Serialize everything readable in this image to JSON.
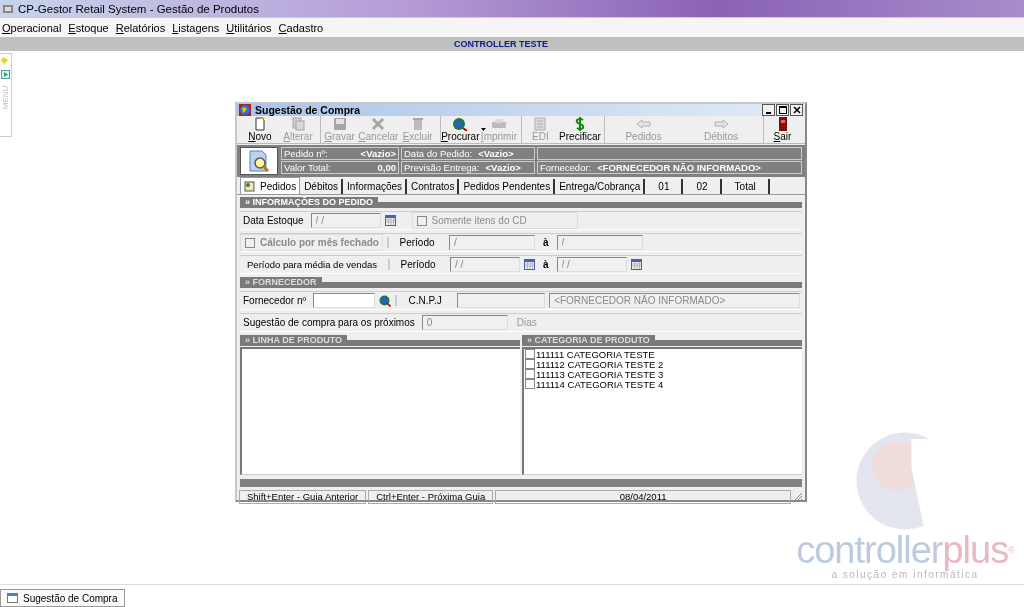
{
  "app": {
    "title": "CP-Gestor Retail System - Gestão de Produtos",
    "menu": [
      {
        "label": "Operacional",
        "mnemonic": true
      },
      {
        "label": "Estoque",
        "mnemonic": true
      },
      {
        "label": "Relatórios",
        "mnemonic": true
      },
      {
        "label": "Listagens",
        "mnemonic": true
      },
      {
        "label": "Utilitários",
        "mnemonic": true
      },
      {
        "label": "Cadastro",
        "mnemonic": true
      }
    ],
    "company": "CONTROLLER TESTE"
  },
  "side_panel": {
    "label": "MENU"
  },
  "window": {
    "title": "Sugestão de Compra",
    "toolbar": [
      {
        "label": "Novo",
        "disabled": false,
        "mnemonic": true,
        "group_start": false,
        "dropdown": false
      },
      {
        "label": "Alterar",
        "disabled": true,
        "mnemonic": true,
        "group_start": false,
        "dropdown": false
      },
      {
        "label": "Gravar",
        "disabled": true,
        "mnemonic": true,
        "group_start": true,
        "dropdown": false
      },
      {
        "label": "Cancelar",
        "disabled": true,
        "mnemonic": true,
        "group_start": false,
        "dropdown": false
      },
      {
        "label": "Excluir",
        "disabled": true,
        "mnemonic": true,
        "group_start": false,
        "dropdown": false
      },
      {
        "label": "Procurar",
        "disabled": false,
        "mnemonic": true,
        "group_start": true,
        "dropdown": true
      },
      {
        "label": "Imprimir",
        "disabled": true,
        "mnemonic": true,
        "group_start": false,
        "dropdown": false
      },
      {
        "label": "EDI",
        "disabled": true,
        "mnemonic": false,
        "group_start": true,
        "dropdown": false
      },
      {
        "label": "Precificar",
        "disabled": false,
        "mnemonic": false,
        "group_start": false,
        "dropdown": false
      },
      {
        "label": "Pedidos",
        "disabled": true,
        "mnemonic": false,
        "group_start": true,
        "dropdown": false
      },
      {
        "label": "Débitos",
        "disabled": true,
        "mnemonic": false,
        "group_start": false,
        "dropdown": false
      },
      {
        "label": "Sair",
        "disabled": false,
        "mnemonic": true,
        "group_start": true,
        "dropdown": false
      }
    ],
    "header": {
      "rows": [
        [
          {
            "label": "Pedido nº:",
            "value": "<Vazio>"
          },
          {
            "label": "Data do Pedido:",
            "value": "<Vazio>"
          }
        ],
        [
          {
            "label": "Valor Total:",
            "value": "0,00"
          },
          {
            "label": "Previsão Entrega:",
            "value": "<Vazio>"
          },
          {
            "label": "Fornecedor:",
            "value": "<FORNECEDOR NÃO INFORMADO>"
          }
        ]
      ]
    },
    "tabs": [
      {
        "label": "Pedidos",
        "selected": true
      },
      {
        "label": "Débitos",
        "selected": false
      },
      {
        "label": "Informações",
        "selected": false
      },
      {
        "label": "Contratos",
        "selected": false
      },
      {
        "label": "Pedidos Pendentes",
        "selected": false
      },
      {
        "label": "Entrega/Cobrança",
        "selected": false
      },
      {
        "label": "01",
        "selected": false
      },
      {
        "label": "02",
        "selected": false
      },
      {
        "label": "Total",
        "selected": false
      }
    ],
    "order_info": {
      "title": "» INFORMAÇÕES DO PEDIDO",
      "stock_date": {
        "label": "Data Estoque",
        "value": "/ /"
      },
      "cd_only": {
        "label": "Somente itens do CD",
        "checked": false,
        "disabled": true
      },
      "closed_month": {
        "label": "Cálculo por mês fechado",
        "checked": false,
        "disabled": true
      },
      "period_1": {
        "label": "Período",
        "from": "/",
        "to_label": "à",
        "to": "/"
      },
      "sales_label": "Período para média de vendas",
      "period_2": {
        "label": "Período",
        "from": "/ /",
        "to_label": "à",
        "to": "/ /"
      }
    },
    "supplier": {
      "title": "» FORNECEDOR",
      "number_label": "Fornecedor nº",
      "cnpj_label": "C.N.P.J",
      "name": "<FORNECEDOR NÃO INFORMADO>",
      "suggestion_label": "Sugestão de compra para os próximos",
      "days": "0",
      "days_unit": "Dias"
    },
    "product_line": {
      "title": "» LINHA DE PRODUTO"
    },
    "category": {
      "title": "» CATEGORIA DE PRODUTO",
      "items": [
        {
          "label": "111111 CATEGORIA TESTE",
          "checked": false
        },
        {
          "label": "111112 CATEGORIA TESTE 2",
          "checked": false
        },
        {
          "label": "111113 CATEGORIA TESTE 3",
          "checked": false
        },
        {
          "label": "111114 CATEGORIA TESTE 4",
          "checked": false
        }
      ]
    },
    "status_bar": [
      "Shift+Enter - Guia Anterior",
      "Ctrl+Enter - Próxima Guia",
      "08/04/2011"
    ]
  },
  "logo": {
    "word": "controller",
    "accent": "plus",
    "mark": "®",
    "tagline": "a solução em informática"
  },
  "taskbar": {
    "items": [
      {
        "label": "Sugestão de Compra",
        "selected": true
      }
    ]
  }
}
